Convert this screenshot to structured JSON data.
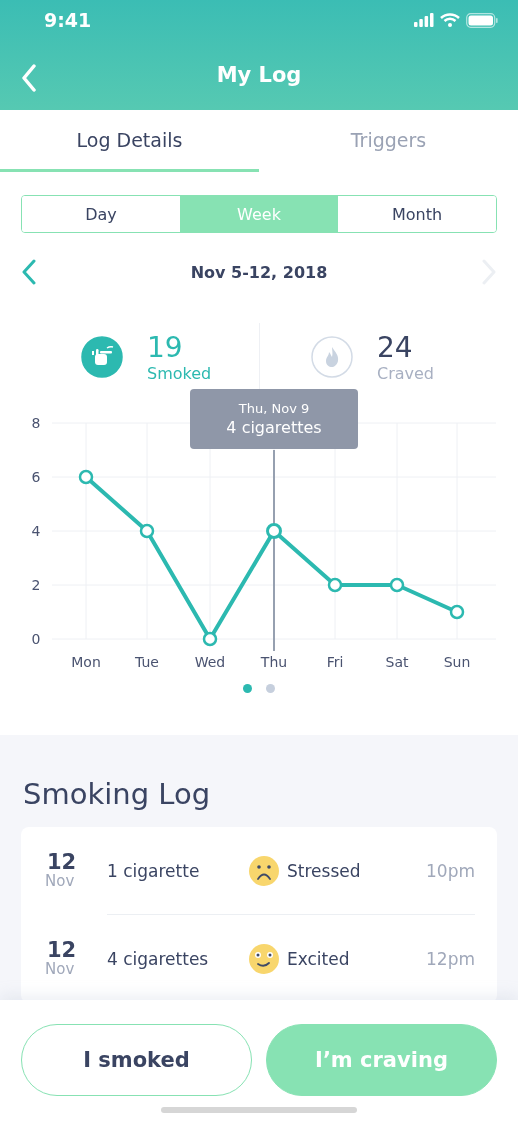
{
  "status_bar": {
    "time": "9:41"
  },
  "nav": {
    "title": "My Log"
  },
  "tabs": [
    {
      "label": "Log Details",
      "selected": true
    },
    {
      "label": "Triggers",
      "selected": false
    }
  ],
  "periods": [
    {
      "label": "Day",
      "selected": false
    },
    {
      "label": "Week",
      "selected": true
    },
    {
      "label": "Month",
      "selected": false
    }
  ],
  "date_range": {
    "label": "Nov 5-12, 2018",
    "next_disabled": true
  },
  "stats": [
    {
      "kind": "smoked",
      "value": "19",
      "label": "Smoked",
      "active": true
    },
    {
      "kind": "craved",
      "value": "24",
      "label": "Craved",
      "active": false
    }
  ],
  "chart": {
    "tooltip": {
      "date": "Thu, Nov 9",
      "text": "4 cigarettes"
    },
    "highlight": [
      false,
      false,
      false,
      true,
      false,
      false,
      false
    ],
    "chart_data": {
      "type": "line",
      "categories": [
        "Mon",
        "Tue",
        "Wed",
        "Thu",
        "Fri",
        "Sat",
        "Sun"
      ],
      "series": [
        {
          "color": "#2cb9b0",
          "marker": "o",
          "values": [
            6,
            4,
            0,
            4,
            2,
            2,
            1
          ]
        }
      ],
      "ylim": [
        0,
        8
      ],
      "yticks": [
        0,
        2,
        4,
        6,
        8
      ],
      "grid": true,
      "ref_lines": [
        {
          "axis": "x",
          "value": "Thu",
          "color": "#96a0b0"
        }
      ]
    }
  },
  "pager": [
    {
      "selected": true
    },
    {
      "selected": false
    }
  ],
  "smoking_log": {
    "title": "Smoking Log",
    "entries": [
      {
        "day": "12",
        "month": "Nov",
        "amount": "1 cigarette",
        "kind": "sad",
        "feeling": "Stressed",
        "time": "10pm"
      },
      {
        "day": "12",
        "month": "Nov",
        "amount": "4 cigarettes",
        "kind": "happy",
        "feeling": "Excited",
        "time": "12pm"
      }
    ]
  },
  "actions": [
    {
      "label": "I smoked",
      "kind": "outline"
    },
    {
      "label": "I’m craving",
      "kind": "filled"
    }
  ]
}
